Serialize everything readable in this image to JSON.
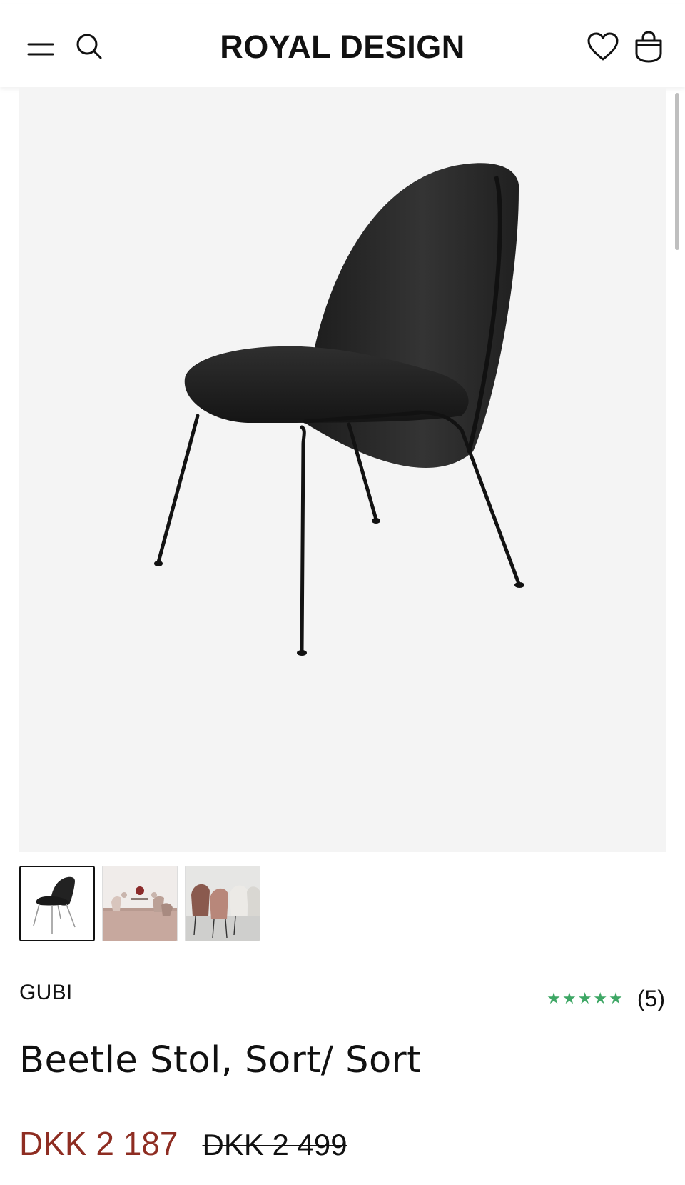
{
  "header": {
    "brand": "ROYAL DESIGN",
    "icons": [
      "menu-icon",
      "search-icon",
      "heart-icon",
      "bag-icon"
    ]
  },
  "gallery": {
    "main_image": "chair-product-image",
    "thumbnails": [
      {
        "name": "chair-thumbnail",
        "active": true
      },
      {
        "name": "room-scene-thumbnail",
        "active": false
      },
      {
        "name": "pink-chairs-thumbnail",
        "active": false
      }
    ]
  },
  "product": {
    "brand": "GUBI",
    "rating": {
      "stars": 5,
      "count_label": "(5)",
      "star_color": "#3ea765"
    },
    "title": "Beetle Stol, Sort/ Sort",
    "price": {
      "current": "DKK 2 187",
      "original": "DKK 2 499",
      "sale_color": "#8e2d22"
    }
  }
}
